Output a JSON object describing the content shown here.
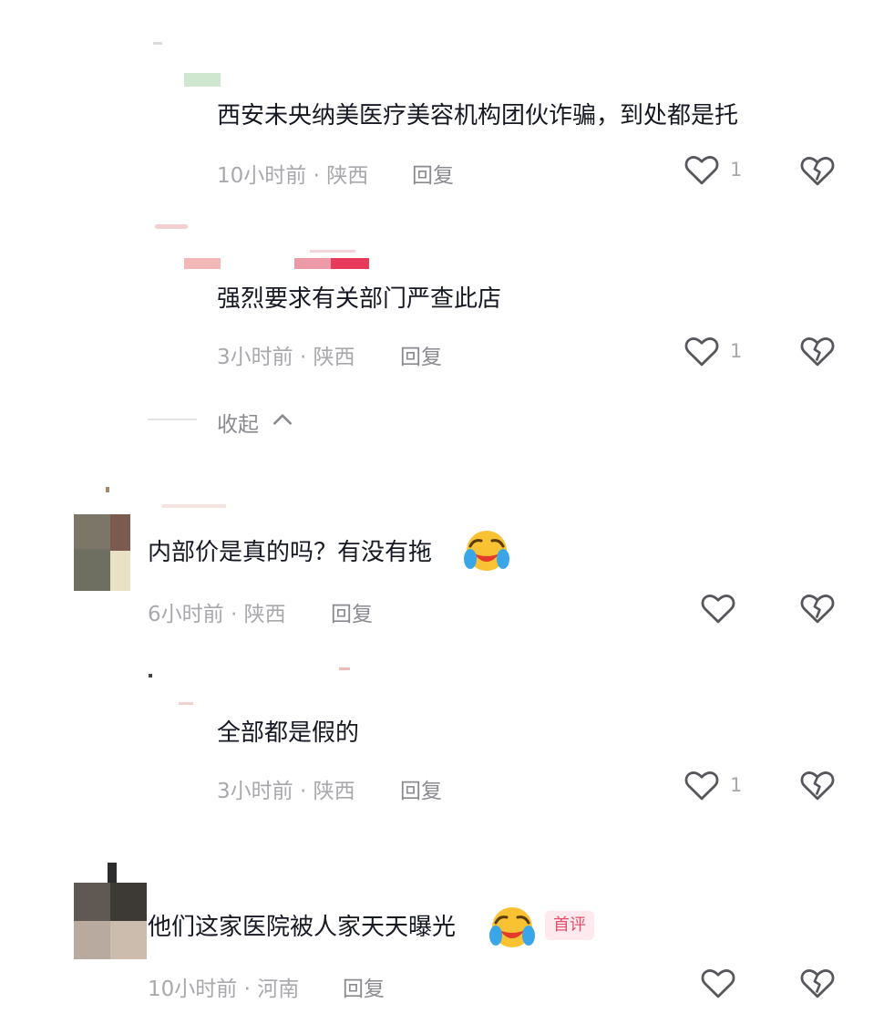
{
  "comments": [
    {
      "text": "西安未央纳美医疗美容机构团伙诈骗，到处都是托",
      "meta": "10小时前 · 陕西",
      "reply": "回复",
      "likes": "1"
    },
    {
      "text": "强烈要求有关部门严查此店",
      "meta": "3小时前 · 陕西",
      "reply": "回复",
      "likes": "1"
    },
    {
      "collapse_label": "收起"
    },
    {
      "text": "内部价是真的吗？有没有拖",
      "meta": "6小时前 · 陕西",
      "reply": "回复",
      "likes": ""
    },
    {
      "text": "全部都是假的",
      "meta": "3小时前 · 陕西",
      "reply": "回复",
      "likes": "1"
    },
    {
      "text": "他们这家医院被人家天天曝光",
      "badge": "首评",
      "meta": "10小时前 · 河南",
      "reply": "回复",
      "likes": ""
    }
  ],
  "icons": {
    "like": "heart-outline-icon",
    "dislike": "broken-heart-icon",
    "collapse": "chevron-up-icon",
    "emoji": "crying-laughing-emoji"
  },
  "colors": {
    "text": "#161823",
    "meta": "#a8a8ad",
    "badge_text": "#e2506b",
    "badge_bg": "#fde9ee"
  }
}
